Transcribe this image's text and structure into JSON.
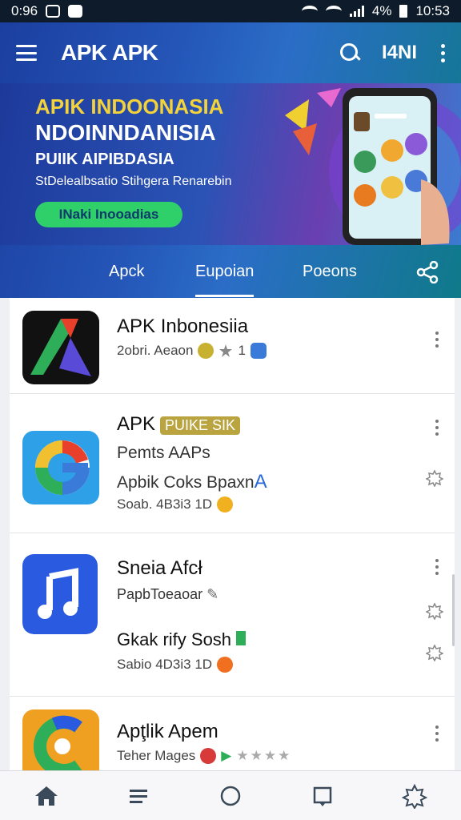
{
  "status_bar": {
    "time_left": "0:96",
    "battery_pct": "4%",
    "time_right": "10:53"
  },
  "appbar": {
    "title": "APK APK",
    "action_label": "I4NI",
    "icons": [
      "menu-icon",
      "search-icon",
      "more-vertical-icon"
    ]
  },
  "banner": {
    "line1": "APIK INDOONASIA",
    "line2": "NDOINNDANISIA",
    "line3": "PUIIK AIPIBDASIA",
    "line4": "StDelealbsatio Stihgera Renarebin",
    "cta": "INaki Inooadias"
  },
  "tabs": [
    {
      "label": "Apck",
      "active": false
    },
    {
      "label": "Eupoian",
      "active": true
    },
    {
      "label": "Poeons",
      "active": false
    }
  ],
  "apps": [
    {
      "title": "APK Inbonesiia",
      "meta": "2obri. Aeaon",
      "rating_badge": "1"
    },
    {
      "title": "APK",
      "badge": "PUIKE SIK",
      "sub1": "Pemts AAPs",
      "sub2": "Apbik Coks Bpaxn",
      "sub2_suffix": "A",
      "meta": "Soab. 4B3i3 1D"
    },
    {
      "title": "Sneia Afcł",
      "sub1": "PapbToeaoar",
      "sub2": "Gkak rify Sosh",
      "meta": "Sabio 4D3i3 1D"
    },
    {
      "title": "Apţlik Apem",
      "meta": "Teher Mages"
    }
  ],
  "bottom_nav": [
    "home-icon",
    "list-icon",
    "circle-home-icon",
    "book-icon",
    "settings-icon"
  ],
  "colors": {
    "header_blue": "#1b3fa0",
    "accent_yellow": "#f4d23a",
    "cta_green": "#2fd06a"
  }
}
